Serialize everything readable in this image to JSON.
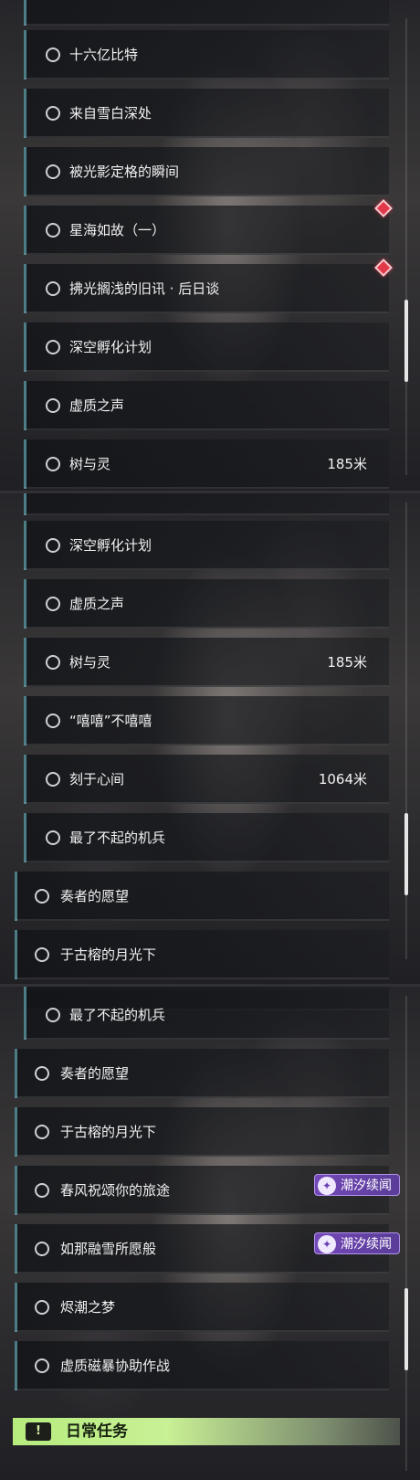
{
  "panel1": {
    "rows": [
      {
        "label": "十六亿比特",
        "distance": ""
      },
      {
        "label": "来自雪白深处",
        "distance": ""
      },
      {
        "label": "被光影定格的瞬间",
        "distance": ""
      },
      {
        "label": "星海如故（一）",
        "distance": ""
      },
      {
        "label": "拂光搁浅的旧讯 · 后日谈",
        "distance": ""
      },
      {
        "label": "深空孵化计划",
        "distance": ""
      },
      {
        "label": "虚质之声",
        "distance": ""
      },
      {
        "label": "树与灵",
        "distance": "185米"
      }
    ],
    "new_markers": [
      "new-marker",
      "new-marker"
    ]
  },
  "panel2": {
    "rows": [
      {
        "label": "深空孵化计划",
        "distance": ""
      },
      {
        "label": "虚质之声",
        "distance": ""
      },
      {
        "label": "树与灵",
        "distance": "185米"
      },
      {
        "label": "“嘻嘻”不嘻嘻",
        "distance": ""
      },
      {
        "label": "刻于心间",
        "distance": "1064米"
      },
      {
        "label": "最了不起的机兵",
        "distance": ""
      },
      {
        "label": "奏者的愿望",
        "distance": ""
      },
      {
        "label": "于古榕的月光下",
        "distance": ""
      }
    ]
  },
  "panel3": {
    "rows": [
      {
        "label": "最了不起的机兵",
        "distance": ""
      },
      {
        "label": "奏者的愿望",
        "distance": ""
      },
      {
        "label": "于古榕的月光下",
        "distance": ""
      },
      {
        "label": "春风祝颂你的旅途",
        "distance": ""
      },
      {
        "label": "如那融雪所愿般",
        "distance": ""
      },
      {
        "label": "烬潮之梦",
        "distance": ""
      },
      {
        "label": "虚质磁暴协助作战",
        "distance": ""
      }
    ],
    "badges": [
      {
        "text": "潮汐续闻",
        "icon": "tide-icon"
      },
      {
        "text": "潮汐续闻",
        "icon": "tide-icon"
      }
    ],
    "daily": {
      "label": "日常任务",
      "icon_glyph": "!"
    }
  },
  "colors": {
    "row_accent": "#4c7c86",
    "new_marker": "#e2384a",
    "badge": "#7348b8",
    "daily_bar": "#b6ec7e"
  }
}
